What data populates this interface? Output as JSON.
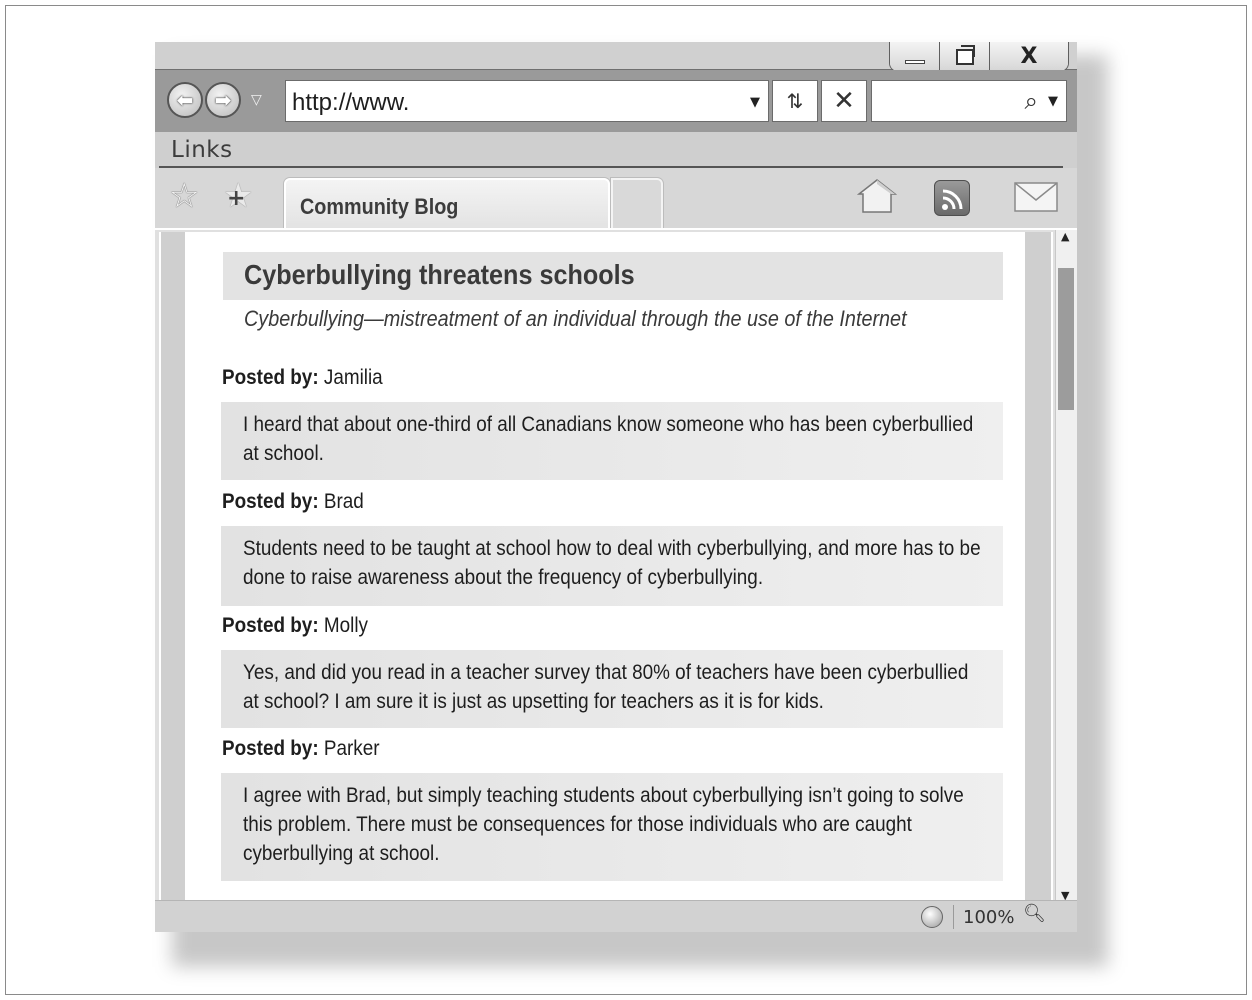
{
  "browser": {
    "address": "http://www.",
    "active_tab": "Community Blog",
    "links_label": "Links",
    "zoom": "100%",
    "window_buttons": {
      "close_label": "X"
    },
    "icons": [
      "back-icon",
      "forward-icon",
      "refresh-icon",
      "stop-icon",
      "search-icon",
      "favorites-star-icon",
      "add-favorites-icon",
      "home-icon",
      "rss-feed-icon",
      "mail-icon",
      "globe-icon",
      "zoom-icon"
    ]
  },
  "blog": {
    "title": "Cyberbullying threatens schools",
    "subtitle": "Cyberbullying—mistreatment of an individual through the use of the Internet",
    "posted_by_label": "Posted by:",
    "posts": [
      {
        "author": "Jamilia",
        "text": "I heard that about one-third of all Canadians know someone who has been cyberbullied at school."
      },
      {
        "author": "Brad",
        "text": "Students need to be taught at school how to deal with cyberbullying, and more has to be done to raise awareness about the frequency of cyberbullying."
      },
      {
        "author": "Molly",
        "text": "Yes, and did you read in a teacher survey that 80% of teachers have been cyberbullied at school? I am sure it is just as upsetting for teachers as it is for kids."
      },
      {
        "author": "Parker",
        "text": "I agree with Brad, but simply teaching students about cyberbullying isn’t going to solve this problem. There must be consequences for those individuals who are caught cyberbullying at school."
      }
    ]
  }
}
